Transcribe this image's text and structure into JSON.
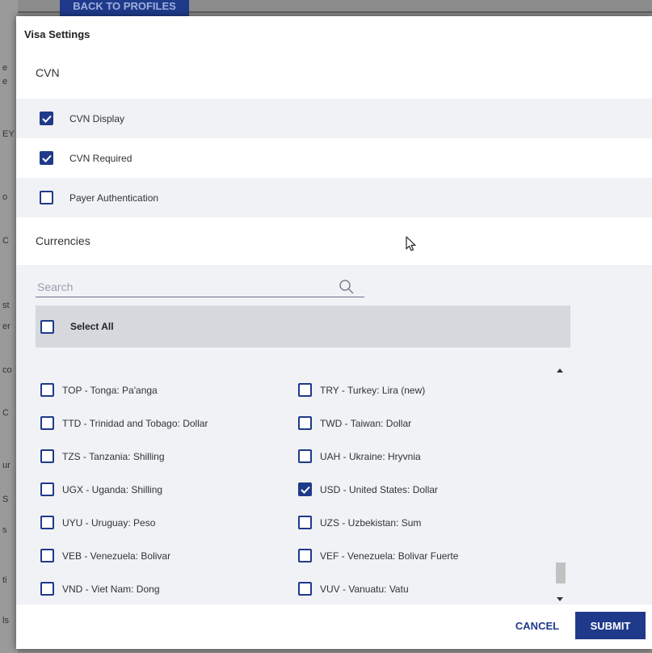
{
  "background": {
    "back_button_label": "BACK TO PROFILES",
    "side_fragments": [
      "e",
      "e",
      "EY",
      "o",
      "C",
      "st",
      "er",
      "co",
      "C",
      "ur",
      "S",
      "s",
      "ti",
      "ls"
    ]
  },
  "modal": {
    "title": "Visa Settings",
    "cvn_section": {
      "heading": "CVN",
      "options": [
        {
          "label": "CVN Display",
          "checked": true
        },
        {
          "label": "CVN Required",
          "checked": true
        },
        {
          "label": "Payer Authentication",
          "checked": false
        }
      ]
    },
    "currencies_section": {
      "heading": "Currencies",
      "search": {
        "placeholder": "Search",
        "value": "",
        "icon": "search-icon"
      },
      "select_all": {
        "label": "Select All",
        "checked": false
      },
      "items": [
        {
          "label": "TOP - Tonga: Pa'anga",
          "checked": false
        },
        {
          "label": "TRY - Turkey: Lira (new)",
          "checked": false
        },
        {
          "label": "TTD - Trinidad and Tobago: Dollar",
          "checked": false
        },
        {
          "label": "TWD - Taiwan: Dollar",
          "checked": false
        },
        {
          "label": "TZS - Tanzania: Shilling",
          "checked": false
        },
        {
          "label": "UAH - Ukraine: Hryvnia",
          "checked": false
        },
        {
          "label": "UGX - Uganda: Shilling",
          "checked": false
        },
        {
          "label": "USD - United States: Dollar",
          "checked": true
        },
        {
          "label": "UYU - Uruguay: Peso",
          "checked": false
        },
        {
          "label": "UZS - Uzbekistan: Sum",
          "checked": false
        },
        {
          "label": "VEB - Venezuela: Bolivar",
          "checked": false
        },
        {
          "label": "VEF - Venezuela: Bolivar Fuerte",
          "checked": false
        },
        {
          "label": "VND - Viet Nam: Dong",
          "checked": false
        },
        {
          "label": "VUV - Vanuatu: Vatu",
          "checked": false
        }
      ]
    },
    "footer": {
      "cancel_label": "CANCEL",
      "submit_label": "SUBMIT"
    }
  },
  "colors": {
    "accent": "#1f3a8a",
    "row_background": "#f0f2f5",
    "select_all_background": "#d6d8de"
  }
}
